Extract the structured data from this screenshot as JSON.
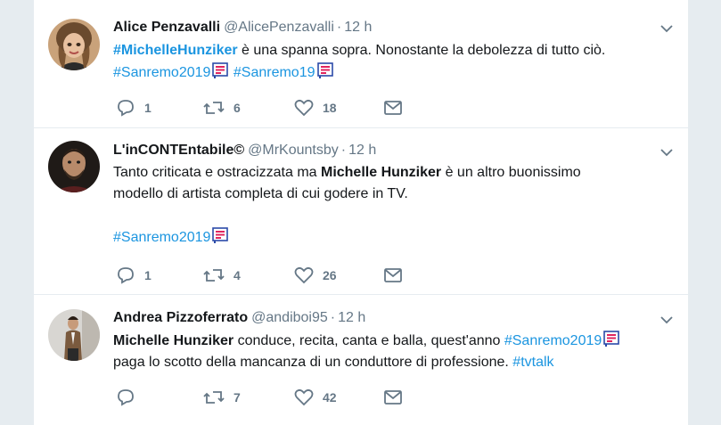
{
  "colors": {
    "link": "#1b95e0",
    "secondary": "#657786",
    "background": "#e6ecf0"
  },
  "tweets": [
    {
      "name": "Alice Penzavalli",
      "handle": "@AlicePenzavalli",
      "separator": "·",
      "time": "12 h",
      "parts": {
        "p1": "#MichelleHunziker",
        "p2": " è una spanna sopra. Nonostante la debolezza di tutto ciò.",
        "p3": "#Sanremo2019",
        "p4": "#Sanremo19"
      },
      "replies": "1",
      "retweets": "6",
      "likes": "18"
    },
    {
      "name": "L'inCONTEntabile©",
      "handle": "@MrKountsby",
      "separator": "·",
      "time": "12 h",
      "parts": {
        "p1": "Tanto criticata e ostracizzata ma ",
        "p2": "Michelle Hunziker",
        "p3": " è un altro buonissimo modello di artista completa di cui godere in TV.",
        "p4": "#Sanremo2019"
      },
      "replies": "1",
      "retweets": "4",
      "likes": "26"
    },
    {
      "name": "Andrea Pizzoferrato",
      "handle": "@andiboi95",
      "separator": "·",
      "time": "12 h",
      "parts": {
        "p1": "Michelle Hunziker",
        "p2": " conduce, recita, canta e balla, quest'anno ",
        "p3": "#Sanremo2019",
        "p4": "paga lo scotto della mancanza di un conduttore di professione. ",
        "p5": "#tvtalk"
      },
      "replies": "",
      "retweets": "7",
      "likes": "42"
    }
  ]
}
